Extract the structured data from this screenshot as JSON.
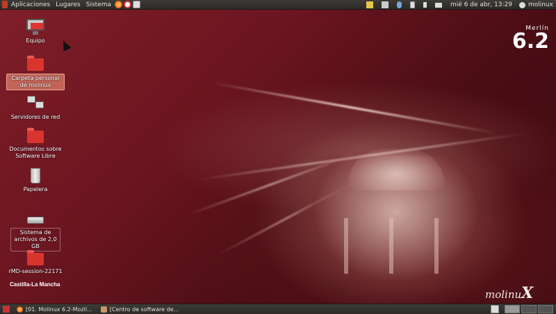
{
  "top_panel": {
    "menus": [
      "Aplicaciones",
      "Lugares",
      "Sistema"
    ],
    "clock": "mié 6 de abr, 13:29",
    "user": "molinux"
  },
  "desktop": {
    "icons": [
      {
        "label": "Equipo"
      },
      {
        "label": "Carpeta personal de molinux"
      },
      {
        "label": "Servidores de red"
      },
      {
        "label": "Documentos sobre Software Libre"
      },
      {
        "label": "Papelera"
      },
      {
        "label": "Sistema de archivos de 2,0 GB"
      },
      {
        "label": "rMD-session-22171"
      }
    ],
    "brand": {
      "small": "Merlín",
      "version": "6.2",
      "bottom": "molinu",
      "bottom_x": "X"
    },
    "castilla": "Castilla-La Mancha"
  },
  "bottom_panel": {
    "tasks": [
      {
        "label": "[01. Molinux 6.2-Mozil..."
      },
      {
        "label": "[Centro de software de..."
      }
    ]
  },
  "colors": {
    "panel": "#3c3b37",
    "desktop_bg": "#6b1520",
    "folder": "#d9352f"
  }
}
